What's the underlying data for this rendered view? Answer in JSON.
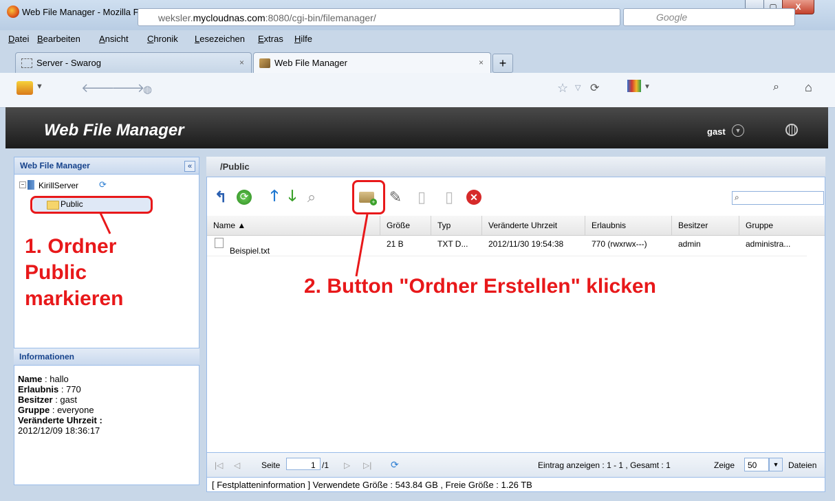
{
  "window": {
    "title": "Web File Manager - Mozilla Firefox",
    "min_label": "▁",
    "max_label": "▢",
    "close_label": "X"
  },
  "menu": [
    "Datei",
    "Bearbeiten",
    "Ansicht",
    "Chronik",
    "Lesezeichen",
    "Extras",
    "Hilfe"
  ],
  "tabs": [
    {
      "label": "Server - Swarog",
      "close": "×"
    },
    {
      "label": "Web File Manager",
      "close": "×"
    }
  ],
  "new_tab": "+",
  "address": {
    "url_prefix": "weksler.",
    "url_domain": "mycloudnas.com",
    "url_suffix": ":8080/cgi-bin/filemanager/",
    "search_placeholder": "Google"
  },
  "app": {
    "logo": "Web File Manager",
    "user": "gast"
  },
  "left_panel": {
    "title": "Web File Manager",
    "collapse": "«",
    "tree_expander": "−",
    "server": "KirillServer",
    "folder": "Public"
  },
  "info": {
    "title": "Informationen",
    "rows": [
      {
        "label": "Name",
        "value": "hallo"
      },
      {
        "label": "Erlaubnis",
        "value": "770"
      },
      {
        "label": "Besitzer",
        "value": "gast"
      },
      {
        "label": "Gruppe",
        "value": "everyone"
      }
    ],
    "modified_label": "Veränderte Uhrzeit :",
    "modified_value": "2012/12/09 18:36:17"
  },
  "main": {
    "path": "/Public",
    "columns": [
      "Name ▲",
      "Größe",
      "Typ",
      "Veränderte Uhrzeit",
      "Erlaubnis",
      "Besitzer",
      "Gruppe"
    ],
    "rows": [
      {
        "name": "Beispiel.txt",
        "size": "21 B",
        "type": "TXT D...",
        "modified": "2012/11/30 19:54:38",
        "perm": "770 (rwxrwx---)",
        "owner": "admin",
        "group": "administra..."
      }
    ]
  },
  "pager": {
    "seite": "Seite",
    "page": "1",
    "of": "/1",
    "summary": "Eintrag anzeigen : 1 - 1 , Gesamt : 1",
    "zeige": "Zeige",
    "per_page": "50",
    "dateien": "Dateien"
  },
  "status": "[ Festplatteninformation ] Verwendete Größe : 543.84 GB , Freie Größe : 1.26 TB",
  "annotations": {
    "step1_line1": "1. Ordner",
    "step1_line2": "Public",
    "step1_line3": "markieren",
    "step2": "2. Button \"Ordner Erstellen\" klicken"
  }
}
